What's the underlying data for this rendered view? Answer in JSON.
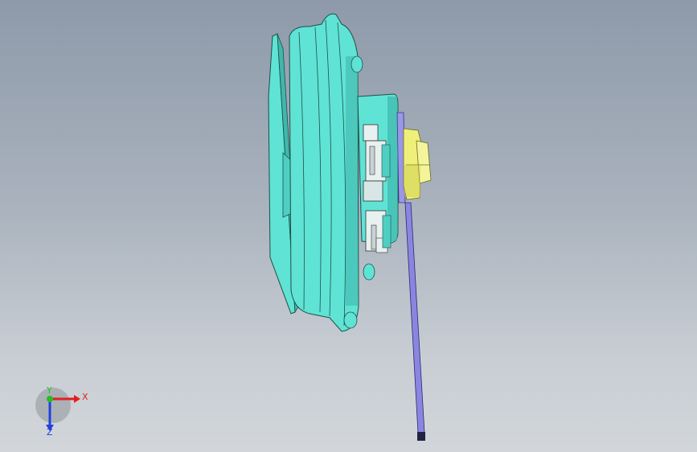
{
  "viewport": {
    "background_top": "#8e9aaa",
    "background_bottom": "#d2d6da"
  },
  "model": {
    "colors": {
      "housing": "#5fe3d4",
      "housing_shade": "#3fb7ac",
      "edge": "#1f4f4a",
      "connector": "#e8f0f0",
      "cap": "#eef07a",
      "cap_shade": "#c9c94a",
      "rod": "#8a86e0",
      "rod_tip": "#222244"
    }
  },
  "triad": {
    "x_label": "X",
    "y_label": "Y",
    "z_label": "Z",
    "x_color": "#e02020",
    "y_color": "#20c020",
    "z_color": "#2040e0"
  }
}
